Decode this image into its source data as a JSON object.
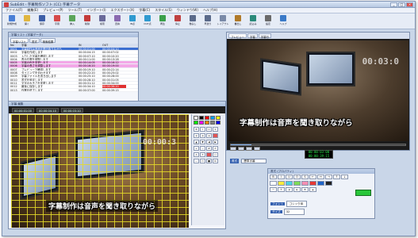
{
  "window": {
    "title": "SubEdit - 字幕制作ソフト (CC) 字幕データ"
  },
  "menu": [
    "ファイル(F)",
    "編集(E)",
    "プレビュー(P)",
    "ツール(T)",
    "インポート(I)",
    "エクスポート(X)",
    "字幕(C)",
    "スタイル(S)",
    "ウィンドウ(W)",
    "ヘルプ(H)"
  ],
  "toolbar": [
    {
      "label": "新規作成",
      "icon": "new-file-icon",
      "color": "#4a7fd6"
    },
    {
      "label": "開く",
      "icon": "open-folder-icon",
      "color": "#e0b640"
    },
    {
      "label": "保存",
      "icon": "save-icon",
      "color": "#3d5fa8"
    },
    {
      "label": "字幕",
      "icon": "caption-icon",
      "color": "#d64a4a"
    },
    {
      "label": "挿入",
      "icon": "insert-icon",
      "color": "#5aa55a"
    },
    {
      "label": "削除",
      "icon": "delete-icon",
      "color": "#c43a3a"
    },
    {
      "label": "検索",
      "icon": "search-icon",
      "color": "#6a6a9a"
    },
    {
      "label": "置換",
      "icon": "replace-icon",
      "color": "#8a6ab0"
    },
    {
      "label": "IN点",
      "icon": "in-point-icon",
      "color": "#2f9ad0"
    },
    {
      "label": "OUT点",
      "icon": "out-point-icon",
      "color": "#2f9ad0"
    },
    {
      "label": "再生",
      "icon": "play-icon",
      "color": "#3aa04a"
    },
    {
      "label": "停止",
      "icon": "stop-icon",
      "color": "#c04040"
    },
    {
      "label": "巻戻し",
      "icon": "rewind-icon",
      "color": "#5a6a8a"
    },
    {
      "label": "早送り",
      "icon": "forward-icon",
      "color": "#5a6a8a"
    },
    {
      "label": "レイアウト",
      "icon": "layout-icon",
      "color": "#7a8aa8"
    },
    {
      "label": "書出し",
      "icon": "export-icon",
      "color": "#b07a2a"
    },
    {
      "label": "読込み",
      "icon": "import-icon",
      "color": "#2a8a7a"
    },
    {
      "label": "設定",
      "icon": "gear-icon",
      "color": "#6a6a6a"
    },
    {
      "label": "ヘルプ",
      "icon": "help-icon",
      "color": "#3a7ac8"
    }
  ],
  "list_panel": {
    "title": "字幕リスト (字幕データ)",
    "tabs": [
      "字幕リスト",
      "書式",
      "検索結果"
    ],
    "headers": [
      "No",
      "字幕",
      "IN",
      "OUT"
    ],
    "rows": [
      {
        "no": "0001",
        "text": "字幕制作は音声を聞き取りながら",
        "in": "00:00:01:00",
        "out": "00:00:04:10",
        "style": "sel"
      },
      {
        "no": "0002",
        "text": "字幕を作成します",
        "in": "00:00:04:15",
        "out": "00:00:07:02",
        "style": ""
      },
      {
        "no": "0003",
        "text": "入力した字幕を確認します",
        "in": "00:00:07:10",
        "out": "00:00:10:20",
        "style": ""
      },
      {
        "no": "0004",
        "text": "表示位置を調整します",
        "in": "00:00:11:00",
        "out": "00:00:13:28",
        "style": ""
      },
      {
        "no": "0005",
        "text": "字幕の色を変更します",
        "in": "00:00:14:05",
        "out": "00:00:16:12",
        "style": "pink"
      },
      {
        "no": "0006",
        "text": "字幕の長さを調整します",
        "in": "00:00:16:20",
        "out": "00:00:19:00",
        "style": "pink"
      },
      {
        "no": "0007",
        "text": "プレビューで確認します",
        "in": "00:00:19:10",
        "out": "00:00:22:14",
        "style": ""
      },
      {
        "no": "0008",
        "text": "タイミングを合わせます",
        "in": "00:00:22:20",
        "out": "00:00:25:02",
        "style": ""
      },
      {
        "no": "0009",
        "text": "字幕ファイルを書き出します",
        "in": "00:00:25:10",
        "out": "00:00:28:00",
        "style": ""
      },
      {
        "no": "0010",
        "text": "書式を設定します",
        "in": "00:00:28:10",
        "out": "00:00:31:05",
        "style": ""
      },
      {
        "no": "0011",
        "text": "文字の大きさを変更します",
        "in": "00:00:31:12",
        "out": "00:00:34:00",
        "style": ""
      },
      {
        "no": "0012",
        "text": "最後に保存します",
        "in": "00:00:34:10",
        "out": "00:00:36:20",
        "style": "red"
      },
      {
        "no": "0013",
        "text": "作業を終了します",
        "in": "00:00:37:00",
        "out": "00:00:39:15",
        "style": ""
      }
    ]
  },
  "edit_panel": {
    "title": "字幕 編集",
    "timecodes": [
      "00:00:01:00",
      "00:00:04:10",
      "00:00:03:10"
    ],
    "caption": "字幕制作は音声を聞き取りながら",
    "overlay_tc": "00:00:3"
  },
  "preview_panel": {
    "title": "プレビュー",
    "tabs": [
      "プレビュー",
      "字幕",
      "字幕行"
    ],
    "caption": "字幕制作は音声を聞き取りながら",
    "overlay_tc": "00:03:0",
    "progress": 0.12
  },
  "status_tc": [
    "00:00:03:00",
    "00:00:39:15"
  ],
  "style_row": {
    "label": "書式",
    "value": "標準字幕"
  },
  "font_panel": {
    "title": "書式 (プロパティ)",
    "font_label": "フォント",
    "font_value": "ゴシック体",
    "size_label": "サイズ",
    "size_value": "32"
  },
  "palette_colors": [
    "#ffffff",
    "#000000",
    "#ff0000",
    "#00a0ff",
    "#ffff00",
    "#00ff00",
    "#ff00ff",
    "#ff8800",
    "#808080",
    "#0000ff"
  ],
  "colors": {
    "grid": "#e6dc28",
    "accent": "#3460b0",
    "highlight_row": "#f3a8e8",
    "tc_green": "#27e84a"
  }
}
